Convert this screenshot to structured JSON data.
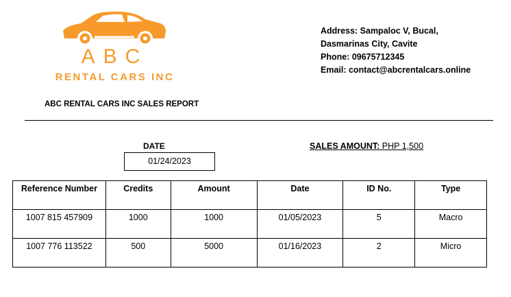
{
  "logo": {
    "icon": "car-icon",
    "brand": "ABC",
    "subtitle": "RENTAL CARS INC",
    "color": "#f79a2b"
  },
  "contact": {
    "address_line1": "Address: Sampaloc V, Bucal,",
    "address_line2": "Dasmarinas City, Cavite",
    "phone": "Phone: 09675712345",
    "email": "Email: contact@abcrentalcars.online"
  },
  "report_title": "ABC RENTAL CARS INC SALES REPORT",
  "date_label": "DATE",
  "date_value": "01/24/2023",
  "sales_label": "SALES AMOUNT:",
  "sales_value": " PHP 1,500",
  "table": {
    "headers": [
      "Reference Number",
      "Credits",
      "Amount",
      "Date",
      "ID No.",
      "Type"
    ],
    "rows": [
      [
        "1007 815 457909",
        "1000",
        "1000",
        "01/05/2023",
        "5",
        "Macro"
      ],
      [
        "1007 776 113522",
        "500",
        "5000",
        "01/16/2023",
        "2",
        "Micro"
      ]
    ]
  }
}
